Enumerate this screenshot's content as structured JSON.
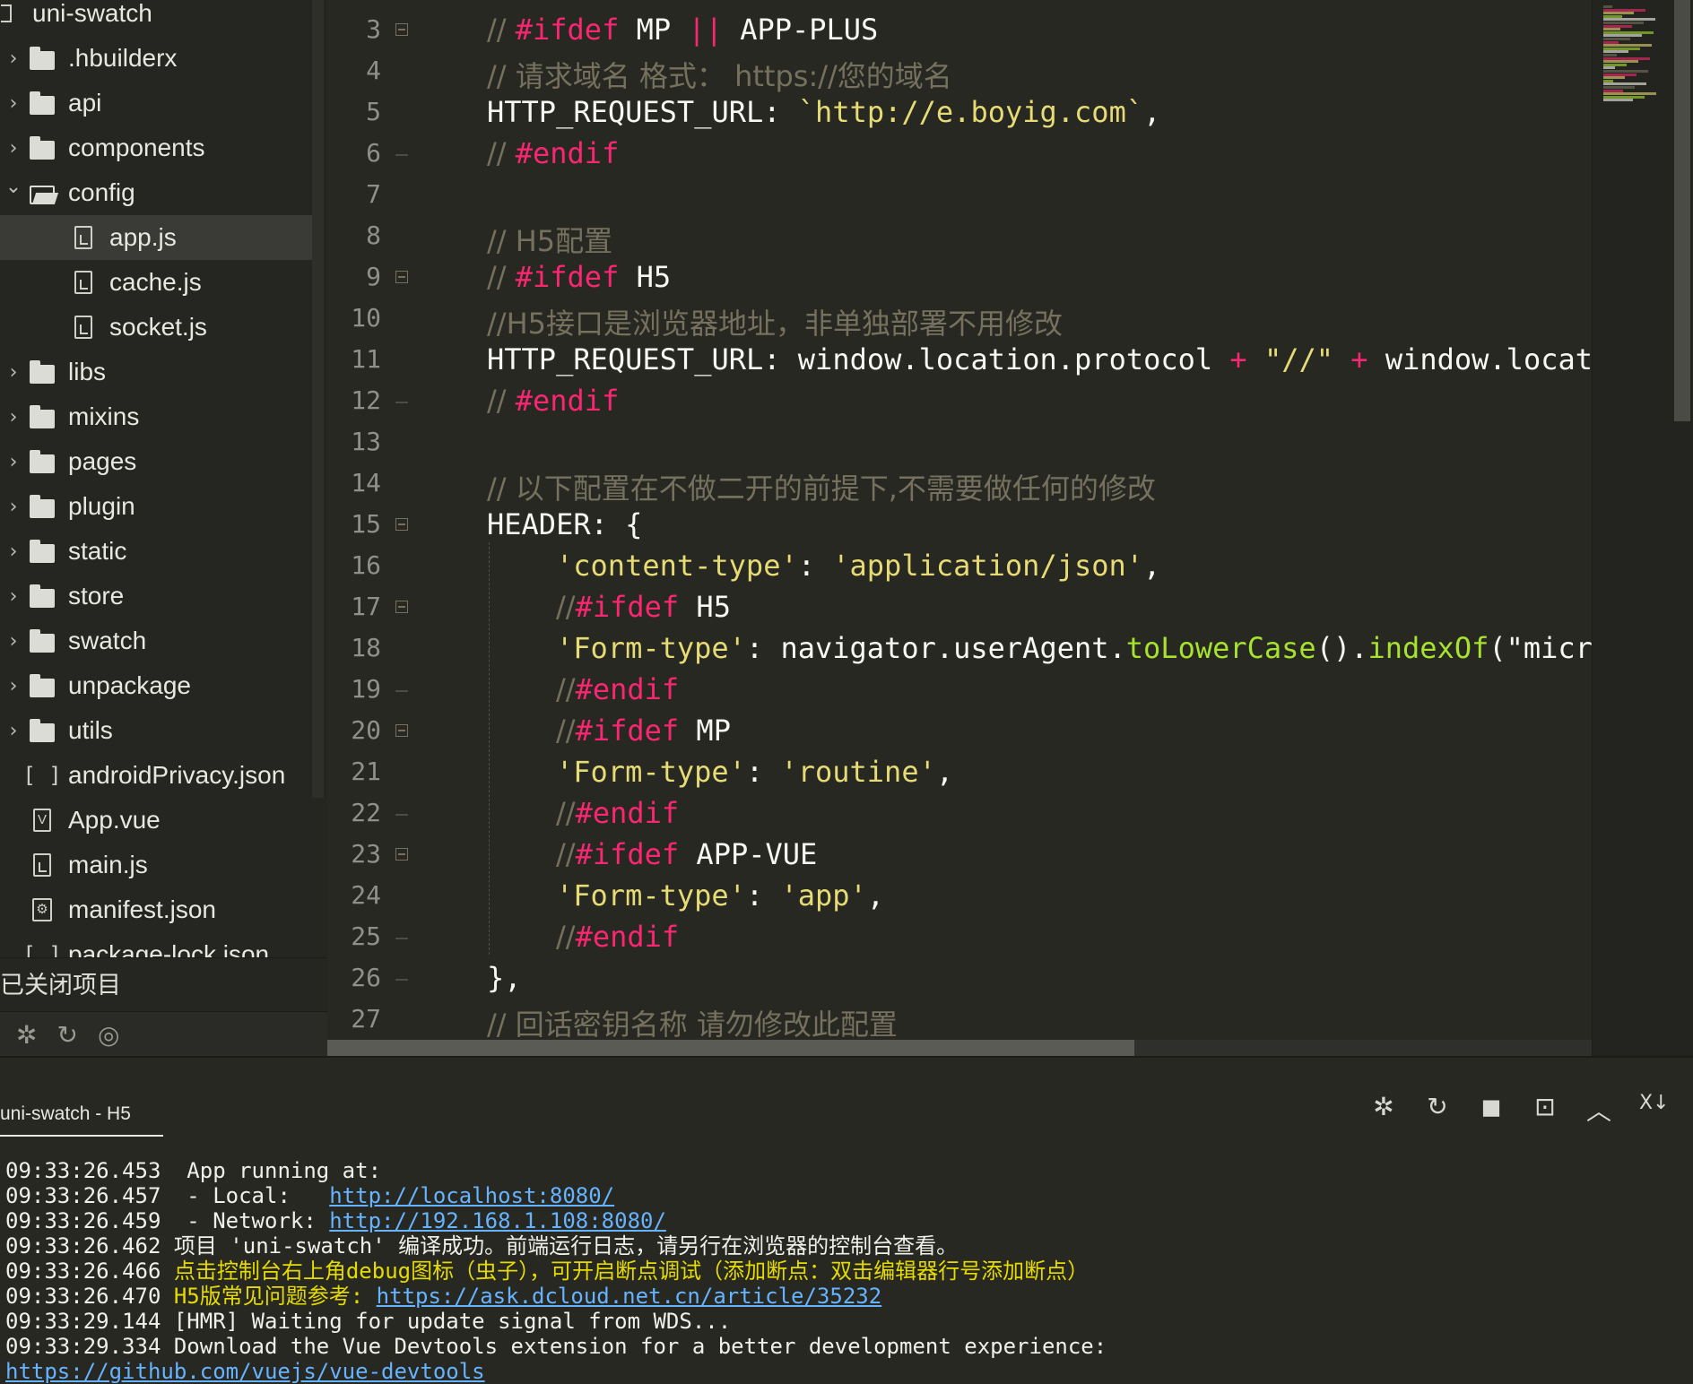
{
  "sidebar": {
    "project_root": "uni-swatch",
    "items": [
      {
        "label": ".hbuilderx",
        "kind": "folder",
        "expanded": false
      },
      {
        "label": "api",
        "kind": "folder",
        "expanded": false
      },
      {
        "label": "components",
        "kind": "folder",
        "expanded": false
      },
      {
        "label": "config",
        "kind": "folder",
        "expanded": true
      },
      {
        "label": "app.js",
        "kind": "file",
        "selected": true
      },
      {
        "label": "cache.js",
        "kind": "file"
      },
      {
        "label": "socket.js",
        "kind": "file"
      },
      {
        "label": "libs",
        "kind": "folder",
        "expanded": false
      },
      {
        "label": "mixins",
        "kind": "folder",
        "expanded": false
      },
      {
        "label": "pages",
        "kind": "folder",
        "expanded": false
      },
      {
        "label": "plugin",
        "kind": "folder",
        "expanded": false
      },
      {
        "label": "static",
        "kind": "folder",
        "expanded": false
      },
      {
        "label": "store",
        "kind": "folder",
        "expanded": false
      },
      {
        "label": "swatch",
        "kind": "folder",
        "expanded": false
      },
      {
        "label": "unpackage",
        "kind": "folder",
        "expanded": false
      },
      {
        "label": "utils",
        "kind": "folder",
        "expanded": false
      },
      {
        "label": "androidPrivacy.json",
        "kind": "json"
      },
      {
        "label": "App.vue",
        "kind": "vue"
      },
      {
        "label": "main.js",
        "kind": "file"
      },
      {
        "label": "manifest.json",
        "kind": "manifest"
      },
      {
        "label": "package-lock.json",
        "kind": "json"
      }
    ],
    "closed_projects_label": "已关闭项目"
  },
  "editor": {
    "line_numbers": [
      "3",
      "4",
      "5",
      "6",
      "7",
      "8",
      "9",
      "10",
      "11",
      "12",
      "13",
      "14",
      "15",
      "16",
      "17",
      "18",
      "19",
      "20",
      "21",
      "22",
      "23",
      "24",
      "25",
      "26",
      "27"
    ],
    "lines": {
      "l3": {
        "a": "// ",
        "b": "#ifdef",
        "c": " MP ",
        "d": "||",
        "e": " APP-PLUS"
      },
      "l4": {
        "a": "// 请求域名 格式： https://您的域名"
      },
      "l5": {
        "a": "HTTP_REQUEST_URL: ",
        "b": "`http://e.boyig.com`",
        "c": ","
      },
      "l6": {
        "a": "// ",
        "b": "#endif"
      },
      "l8": {
        "a": "// H5配置"
      },
      "l9": {
        "a": "// ",
        "b": "#ifdef",
        "c": " H5"
      },
      "l10": {
        "a": "//H5接口是浏览器地址，非单独部署不用修改"
      },
      "l11": {
        "a": "HTTP_REQUEST_URL: window.location.protocol ",
        "b": "+",
        "c": " \"//\" ",
        "d": "+",
        "e": " window.locat"
      },
      "l12": {
        "a": "// ",
        "b": "#endif"
      },
      "l14": {
        "a": "// 以下配置在不做二开的前提下,不需要做任何的修改"
      },
      "l15": {
        "a": "HEADER: {"
      },
      "l16": {
        "a": "'content-type'",
        "b": ": ",
        "c": "'application/json'",
        "d": ","
      },
      "l17": {
        "a": "//",
        "b": "#ifdef",
        "c": " H5"
      },
      "l18": {
        "a": "'Form-type'",
        "b": ": navigator.userAgent.",
        "c": "toLowerCase",
        "d": "().",
        "e": "indexOf",
        "f": "(\"micr"
      },
      "l19": {
        "a": "//",
        "b": "#endif"
      },
      "l20": {
        "a": "//",
        "b": "#ifdef",
        "c": " MP"
      },
      "l21": {
        "a": "'Form-type'",
        "b": ": ",
        "c": "'routine'",
        "d": ","
      },
      "l22": {
        "a": "//",
        "b": "#endif"
      },
      "l23": {
        "a": "//",
        "b": "#ifdef",
        "c": " APP-VUE"
      },
      "l24": {
        "a": "'Form-type'",
        "b": ": ",
        "c": "'app'",
        "d": ","
      },
      "l25": {
        "a": "//",
        "b": "#endif"
      },
      "l26": {
        "a": "},"
      },
      "l27": {
        "a": "// 回话密钥名称 请勿修改此配置"
      }
    }
  },
  "console": {
    "tab_label": "uni-swatch - H5",
    "logs": [
      {
        "ts": "09:33:26.453",
        "text": " App running at:"
      },
      {
        "ts": "09:33:26.457",
        "text": " - Local:   ",
        "link": "http://localhost:8080/"
      },
      {
        "ts": "09:33:26.459",
        "text": " - Network: ",
        "link": "http://192.168.1.108:8080/"
      },
      {
        "ts": "09:33:26.462",
        "text": "项目 'uni-swatch' 编译成功。前端运行日志，请另行在浏览器的控制台查看。"
      },
      {
        "ts": "09:33:26.466",
        "warn": "点击控制台右上角debug图标（虫子），可开启断点调试（添加断点：双击编辑器行号添加断点）"
      },
      {
        "ts": "09:33:26.470",
        "warn": "H5版常见问题参考: ",
        "link": "https://ask.dcloud.net.cn/article/35232"
      },
      {
        "ts": "09:33:29.144",
        "text": "[HMR] Waiting for update signal from WDS..."
      },
      {
        "ts": "09:33:29.334",
        "text": "Download the Vue Devtools extension for a better development experience:"
      },
      {
        "ts": "",
        "link": "https://github.com/vuejs/vue-devtools"
      }
    ]
  },
  "colors": {
    "background": "#272822",
    "comment": "#75715e",
    "keyword": "#f92672",
    "string": "#e6db74",
    "function": "#a6e22e",
    "link": "#66b3ff",
    "warning": "#e6db00"
  }
}
